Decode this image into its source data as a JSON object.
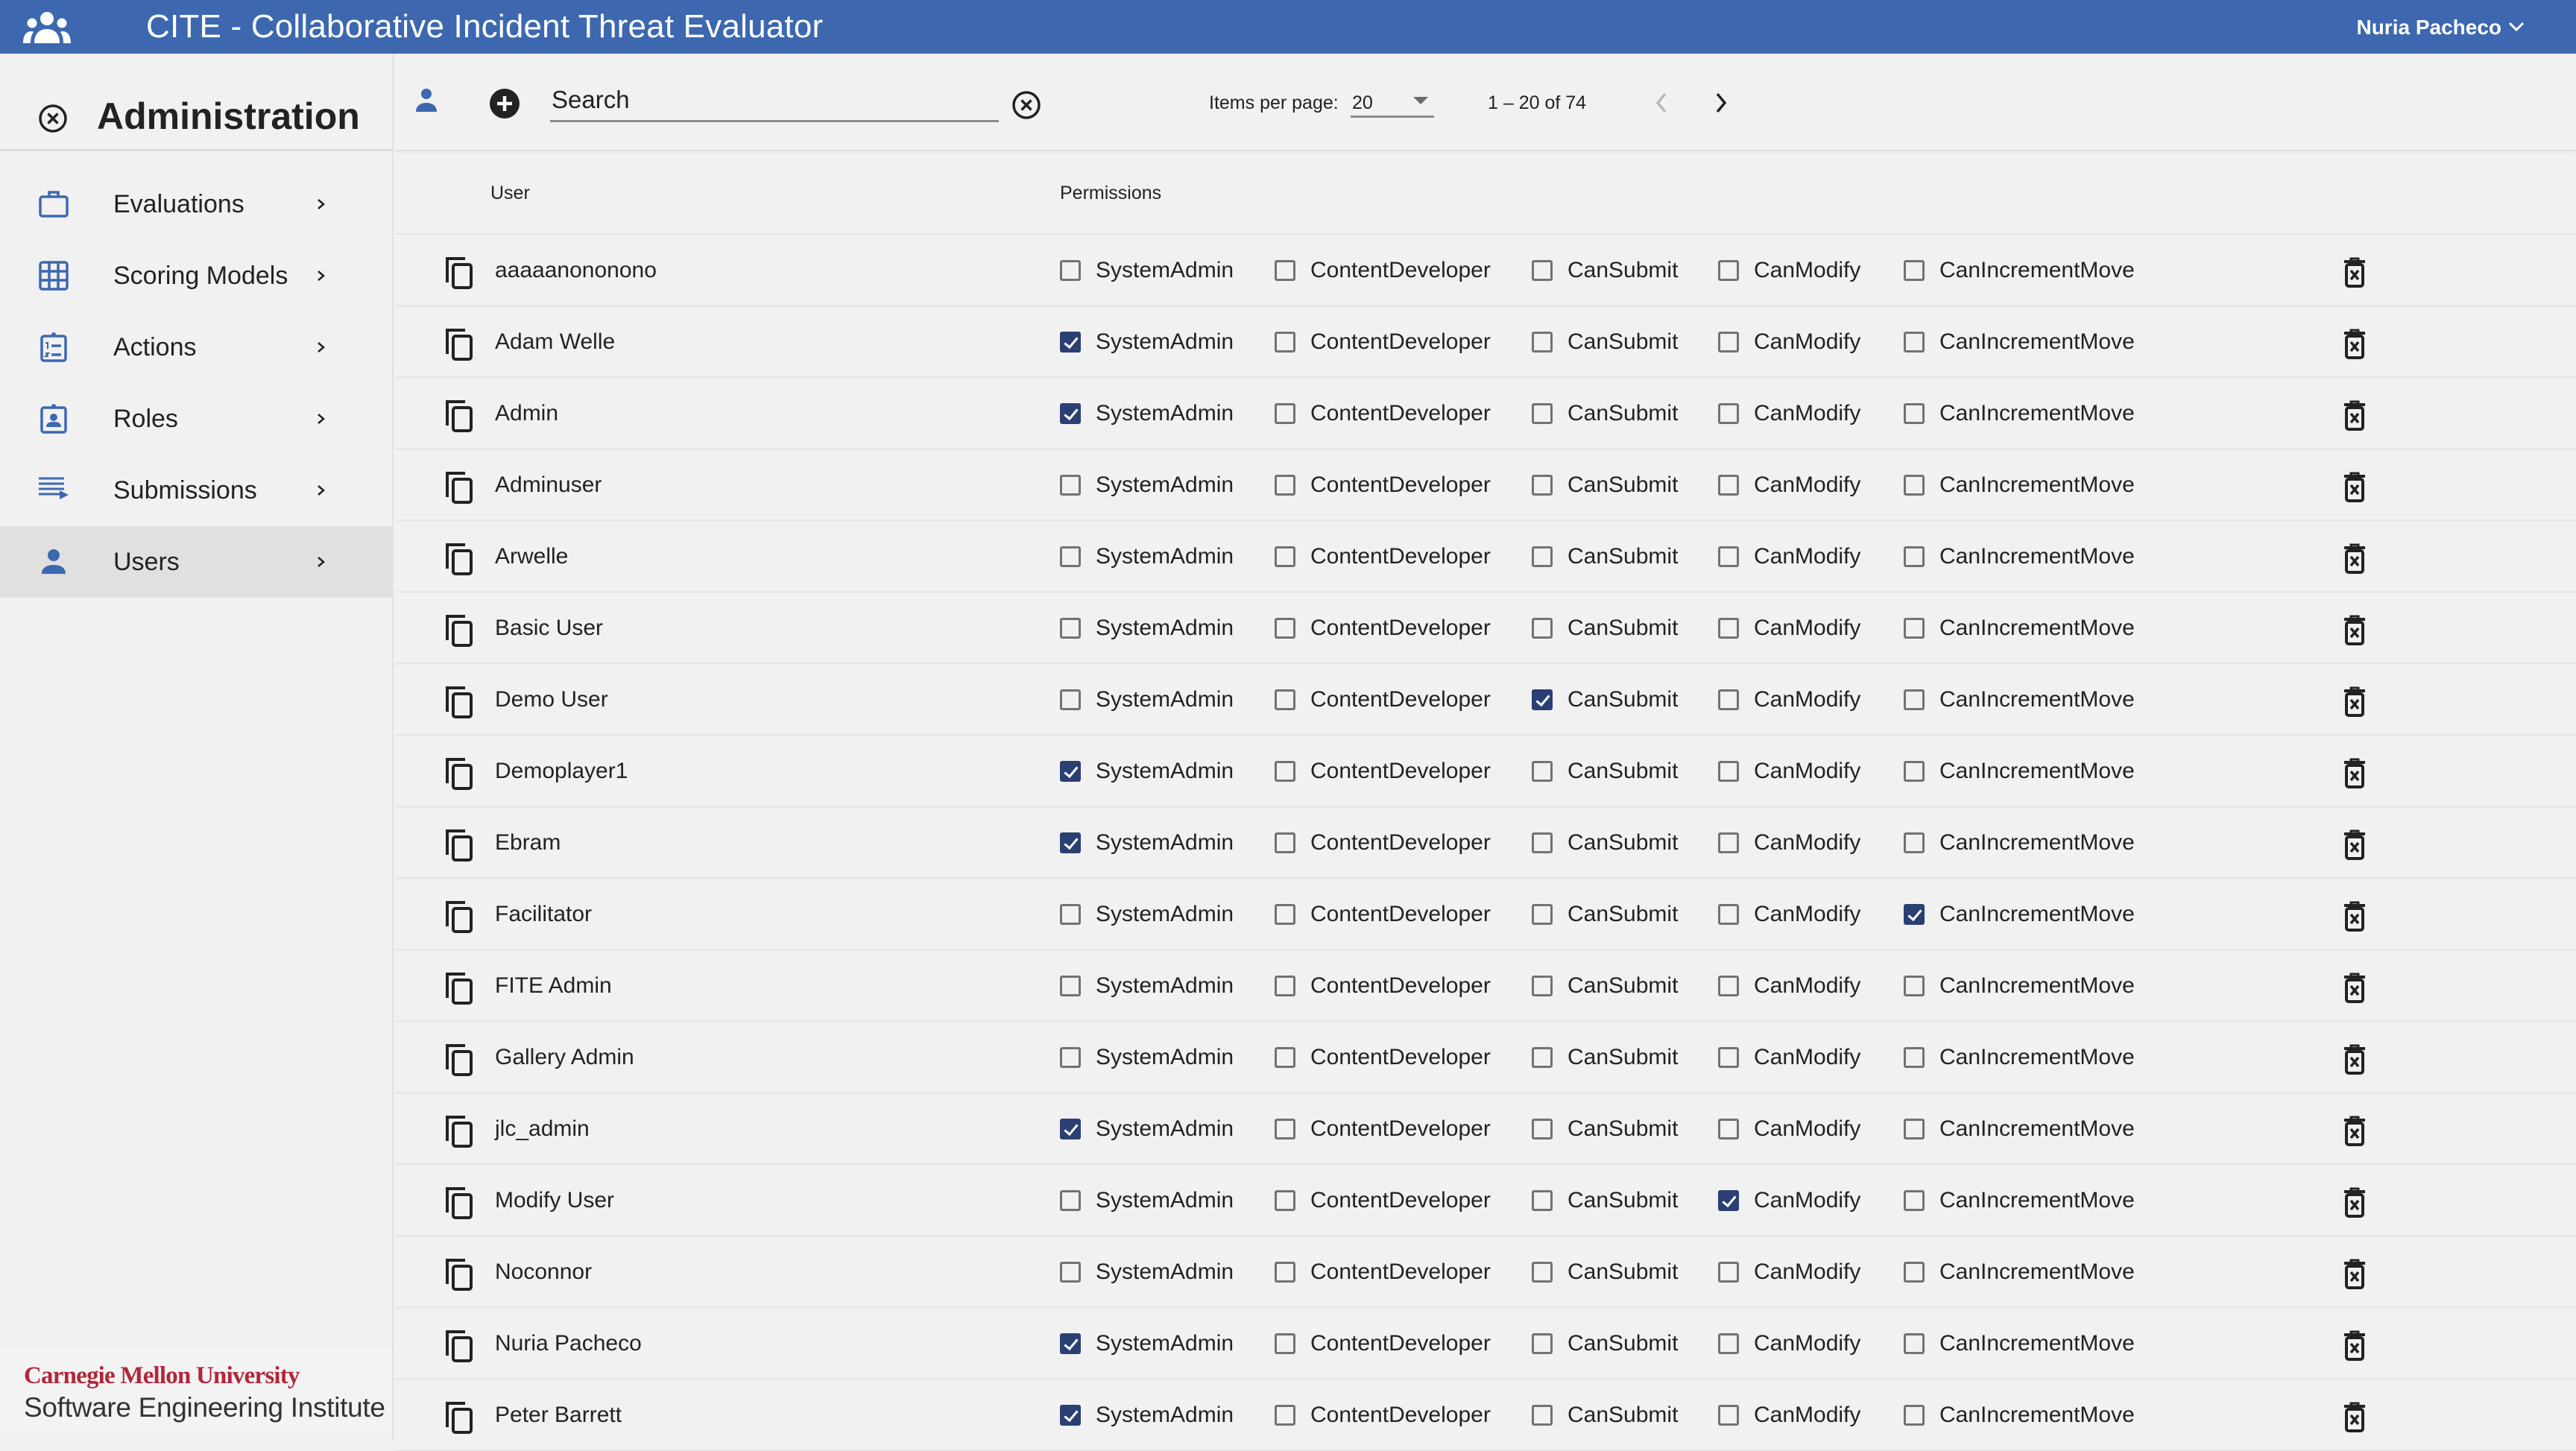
{
  "app": {
    "title": "CITE - Collaborative Incident Threat Evaluator",
    "icon": "group-icon",
    "current_user": "Nuria Pacheco",
    "brand_color": "#3d68b0",
    "checkbox_color": "#2b3f73"
  },
  "sidebar": {
    "heading": "Administration",
    "close_icon": "close-circle-icon",
    "items": [
      {
        "label": "Evaluations",
        "icon": "briefcase-icon",
        "active": false
      },
      {
        "label": "Scoring Models",
        "icon": "grid-icon",
        "active": false
      },
      {
        "label": "Actions",
        "icon": "numbered-clipboard-icon",
        "active": false
      },
      {
        "label": "Roles",
        "icon": "badge-icon",
        "active": false
      },
      {
        "label": "Submissions",
        "icon": "playlist-icon",
        "active": false
      },
      {
        "label": "Users",
        "icon": "person-icon",
        "active": true
      }
    ],
    "logo": {
      "line1": "Carnegie Mellon University",
      "line2": "Software Engineering Institute"
    }
  },
  "toolbar": {
    "search_placeholder": "Search",
    "search_value": "",
    "items_per_page_label": "Items per page:",
    "items_per_page_value": "20",
    "range_label": "1 – 20 of 74"
  },
  "table": {
    "columns": {
      "user": "User",
      "permissions": "Permissions"
    },
    "permission_names": [
      "SystemAdmin",
      "ContentDeveloper",
      "CanSubmit",
      "CanModify",
      "CanIncrementMove"
    ],
    "rows": [
      {
        "name": "aaaaanononono",
        "perms": [
          false,
          false,
          false,
          false,
          false
        ]
      },
      {
        "name": "Adam Welle",
        "perms": [
          true,
          false,
          false,
          false,
          false
        ]
      },
      {
        "name": "Admin",
        "perms": [
          true,
          false,
          false,
          false,
          false
        ]
      },
      {
        "name": "Adminuser",
        "perms": [
          false,
          false,
          false,
          false,
          false
        ]
      },
      {
        "name": "Arwelle",
        "perms": [
          false,
          false,
          false,
          false,
          false
        ]
      },
      {
        "name": "Basic User",
        "perms": [
          false,
          false,
          false,
          false,
          false
        ]
      },
      {
        "name": "Demo User",
        "perms": [
          false,
          false,
          true,
          false,
          false
        ]
      },
      {
        "name": "Demoplayer1",
        "perms": [
          true,
          false,
          false,
          false,
          false
        ]
      },
      {
        "name": "Ebram",
        "perms": [
          true,
          false,
          false,
          false,
          false
        ]
      },
      {
        "name": "Facilitator",
        "perms": [
          false,
          false,
          false,
          false,
          true
        ]
      },
      {
        "name": "FITE Admin",
        "perms": [
          false,
          false,
          false,
          false,
          false
        ]
      },
      {
        "name": "Gallery Admin",
        "perms": [
          false,
          false,
          false,
          false,
          false
        ]
      },
      {
        "name": "jlc_admin",
        "perms": [
          true,
          false,
          false,
          false,
          false
        ]
      },
      {
        "name": "Modify User",
        "perms": [
          false,
          false,
          false,
          true,
          false
        ]
      },
      {
        "name": "Noconnor",
        "perms": [
          false,
          false,
          false,
          false,
          false
        ]
      },
      {
        "name": "Nuria Pacheco",
        "perms": [
          true,
          false,
          false,
          false,
          false
        ]
      },
      {
        "name": "Peter Barrett",
        "perms": [
          true,
          false,
          false,
          false,
          false
        ]
      }
    ]
  }
}
